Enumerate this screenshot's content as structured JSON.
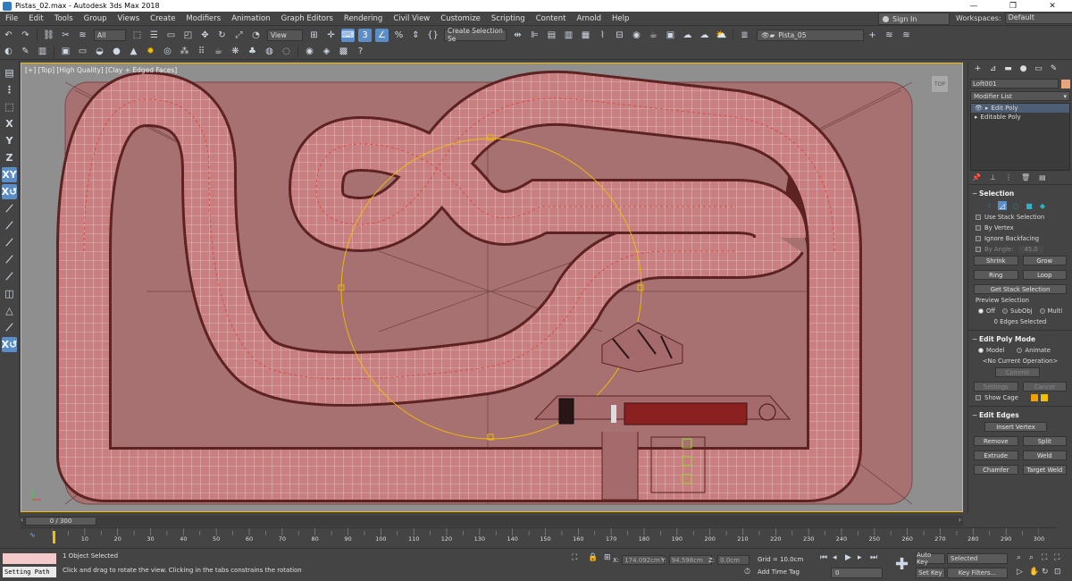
{
  "window": {
    "title": "Pistas_02.max - Autodesk 3ds Max 2018",
    "controls": [
      "—",
      "❐",
      "✕"
    ]
  },
  "menu": [
    "File",
    "Edit",
    "Tools",
    "Group",
    "Views",
    "Create",
    "Modifiers",
    "Animation",
    "Graph Editors",
    "Rendering",
    "Civil View",
    "Customize",
    "Scripting",
    "Content",
    "Arnold",
    "Help"
  ],
  "signin": {
    "label": "Sign In"
  },
  "workspaces": {
    "label": "Workspaces:",
    "value": "Default"
  },
  "toolbar1": {
    "selection_filter": "All",
    "ref_coord": "View",
    "named_selection": "Create Selection Se",
    "layer": "Pista_05"
  },
  "viewport": {
    "label": "[+] [Top] [High Quality] [Clay + Edged Faces]",
    "viewcube_label": "TOP",
    "track_color": "#c97f7f",
    "ground_color": "#a77071",
    "wire_color": "#ffffff",
    "accent_color": "#f0c000"
  },
  "command_panel": {
    "tabs": [
      "+",
      "⊿",
      "▬",
      "●",
      "▭",
      "✎"
    ],
    "object_name": "Loft001",
    "object_color": "#e8a67a",
    "modifier_list": "Modifier List",
    "stack": [
      "Edit Poly",
      "Editable Poly"
    ],
    "selection": {
      "title": "Selection",
      "use_stack": "Use Stack Selection",
      "by_vertex": "By Vertex",
      "ignore_backfacing": "Ignore Backfacing",
      "by_angle_label": "By Angle:",
      "by_angle_value": "45.0",
      "shrink": "Shrink",
      "grow": "Grow",
      "ring": "Ring",
      "loop": "Loop",
      "get_stack_selection": "Get Stack Selection",
      "preview_label": "Preview Selection",
      "preview_off": "Off",
      "preview_subobj": "SubObj",
      "preview_multi": "Multi",
      "status": "0 Edges Selected"
    },
    "edit_poly_mode": {
      "title": "Edit Poly Mode",
      "model": "Model",
      "animate": "Animate",
      "current_op": "<No Current Operation>",
      "commit": "Commit",
      "settings": "Settings",
      "cancel": "Cancel",
      "show_cage": "Show Cage"
    },
    "edit_edges": {
      "title": "Edit Edges",
      "insert_vertex": "Insert Vertex",
      "remove": "Remove",
      "split": "Split",
      "extrude": "Extrude",
      "weld": "Weld",
      "chamfer": "Chamfer",
      "target_weld": "Target Weld"
    }
  },
  "timeline": {
    "frame": "0 / 300",
    "ticks": [
      "0",
      "10",
      "20",
      "30",
      "40",
      "50",
      "60",
      "70",
      "80",
      "90",
      "100",
      "110",
      "120",
      "130",
      "140",
      "150",
      "160",
      "170",
      "180",
      "190",
      "200",
      "210",
      "220",
      "230",
      "240",
      "250",
      "260",
      "270",
      "280",
      "290",
      "300"
    ]
  },
  "status": {
    "maxscript": "Setting Path",
    "selected": "1 Object Selected",
    "prompt": "Click and drag to rotate the view.  Clicking in the tabs constrains the rotation",
    "x_label": "X:",
    "x_value": "174.092cm",
    "y_label": "Y:",
    "y_value": "94.598cm",
    "z_label": "Z:",
    "z_value": "0.0cm",
    "grid": "Grid = 10.0cm",
    "add_time_tag": "Add Time Tag",
    "auto_key": "Auto Key",
    "set_key": "Set Key",
    "key_mode": "Selected",
    "key_filters": "Key Filters...",
    "current_frame": "0"
  }
}
